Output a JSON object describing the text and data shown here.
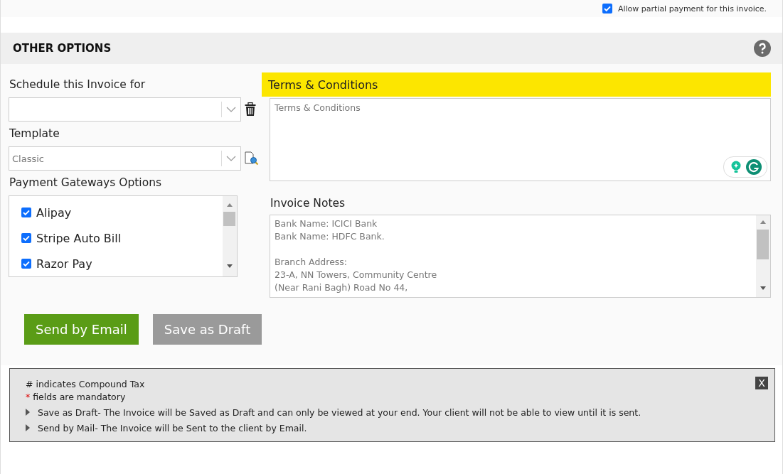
{
  "partial_payment": {
    "label": "Allow partial payment for this invoice.",
    "checked": true
  },
  "section": {
    "title": "OTHER OPTIONS"
  },
  "schedule": {
    "label": "Schedule this Invoice for"
  },
  "template": {
    "label": "Template",
    "value": "Classic"
  },
  "gateways": {
    "label": "Payment Gateways Options",
    "items": [
      {
        "label": "Alipay",
        "checked": true
      },
      {
        "label": "Stripe Auto Bill",
        "checked": true
      },
      {
        "label": "Razor Pay",
        "checked": true
      }
    ]
  },
  "terms": {
    "label": "Terms & Conditions",
    "placeholder": "Terms & Conditions"
  },
  "notes": {
    "label": "Invoice Notes",
    "paragraphs": [
      [
        "Bank Name: ICICI Bank",
        "Bank Name: HDFC Bank."
      ],
      [
        "Branch Address:",
        "23-A, NN Towers, Community Centre",
        "(Near Rani Bagh) Road No 44,"
      ]
    ]
  },
  "buttons": [
    {
      "label": "Send by Email",
      "kind": "primary"
    },
    {
      "label": "Save as Draft",
      "kind": "secondary"
    }
  ],
  "info": {
    "lines": [
      {
        "kind": "plain",
        "text": "# indicates Compound Tax"
      },
      {
        "kind": "required",
        "mark": "*",
        "text": "fields are mandatory"
      },
      {
        "kind": "bullet",
        "text": "Save as Draft- The Invoice will be Saved as Draft and can only be viewed at your end. Your client will not be able to view until it is sent."
      },
      {
        "kind": "bullet",
        "text": "Send by Mail- The Invoice will be Sent to the client by Email."
      }
    ],
    "close": "X"
  }
}
